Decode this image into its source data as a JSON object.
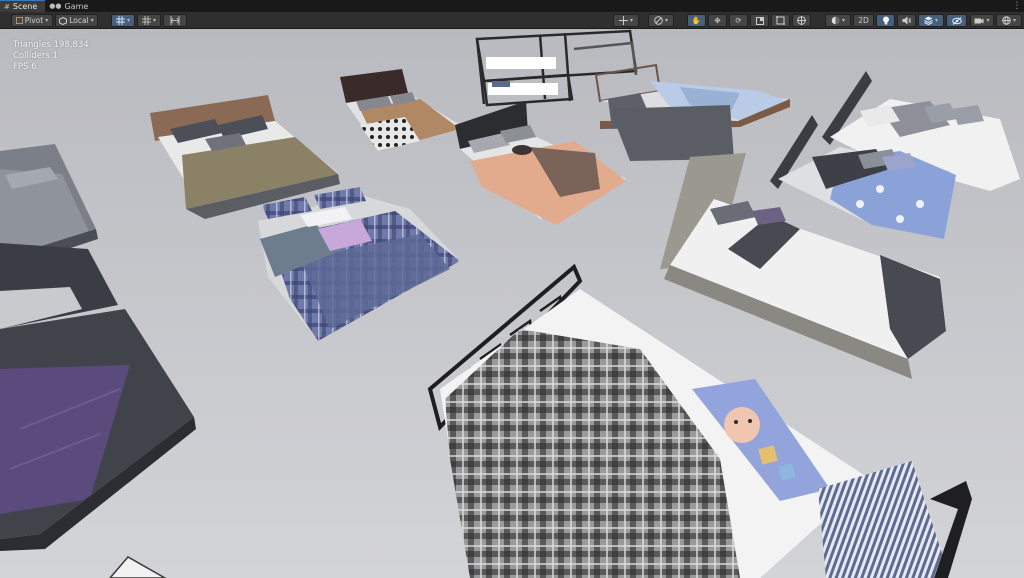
{
  "tabs": [
    {
      "label": "Scene",
      "icon": "grid-icon",
      "active": true
    },
    {
      "label": "Game",
      "icon": "gamepad-icon",
      "active": false
    }
  ],
  "toolbar": {
    "pivot_label": "Pivot",
    "local_label": "Local",
    "mode_2d_label": "2D"
  },
  "stats": {
    "triangles": "Triangles 198,834",
    "colliders": "Colliders 1",
    "fps": "FPS 6"
  },
  "colors": {
    "accent": "#3a79bb",
    "toolbar_bg": "#2f2f2f",
    "viewport_bg": "#c6c7cc"
  }
}
